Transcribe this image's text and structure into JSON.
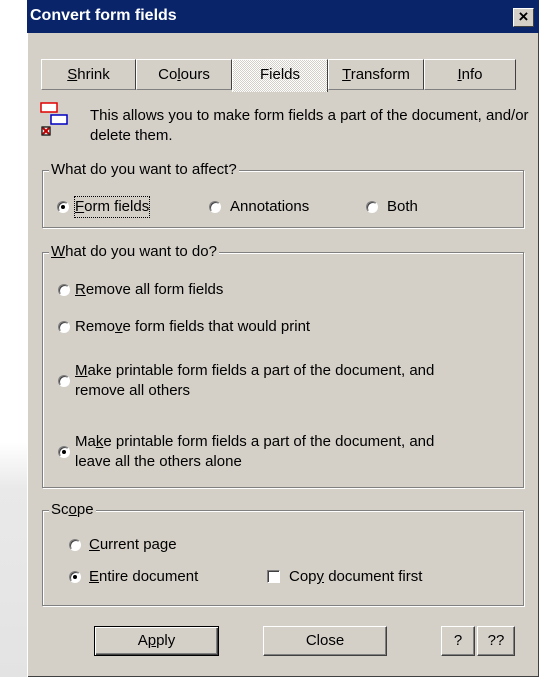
{
  "window": {
    "title": "Convert form fields",
    "close_glyph": "×"
  },
  "tabs": [
    {
      "pre": "",
      "key": "S",
      "post": "hrink"
    },
    {
      "pre": "Co",
      "key": "l",
      "post": "ours"
    },
    {
      "pre": "Fields",
      "key": "",
      "post": ""
    },
    {
      "pre": "",
      "key": "T",
      "post": "ransform"
    },
    {
      "pre": "",
      "key": "I",
      "post": "nfo"
    }
  ],
  "active_tab": "Fields",
  "info": {
    "icon": "form-fields-icon",
    "text": "This allows you to make form fields a part of the document, and/or delete them."
  },
  "affect": {
    "label": "What do you want to affect?",
    "options": [
      {
        "pre": "",
        "key": "F",
        "post": "orm fields",
        "checked": true
      },
      {
        "pre": "Annotations",
        "key": "",
        "post": "",
        "checked": false
      },
      {
        "pre": "Both",
        "key": "",
        "post": "",
        "checked": false
      }
    ]
  },
  "todo": {
    "label_key": "W",
    "label_rest": "hat do you want to do?",
    "options": [
      {
        "pre": "",
        "key": "R",
        "post": "emove all form fields",
        "line2": "",
        "checked": false
      },
      {
        "pre": "Remo",
        "key": "v",
        "post": "e form fields that would print",
        "line2": "",
        "checked": false
      },
      {
        "pre": "",
        "key": "M",
        "post": "ake printable form fields a part of the document, and",
        "line2": "remove all others",
        "checked": false
      },
      {
        "pre": "Ma",
        "key": "k",
        "post": "e printable form fields a part of the document, and",
        "line2": "leave all the others alone",
        "checked": true
      }
    ]
  },
  "scope": {
    "label_pre": "Sc",
    "label_key": "o",
    "label_post": "pe",
    "current": {
      "pre": "",
      "key": "C",
      "post": "urrent page",
      "checked": false
    },
    "entire": {
      "pre": "",
      "key": "E",
      "post": "ntire document",
      "checked": true
    },
    "copy": {
      "pre": "Cop",
      "key": "y",
      "post": " document first",
      "checked": false
    }
  },
  "buttons": {
    "apply_pre": "A",
    "apply_key": "p",
    "apply_post": "ply",
    "close": "Close",
    "help": "?",
    "help2": "??"
  },
  "colors": {
    "titlebar": "#0a246a",
    "face": "#d4d0c8"
  }
}
